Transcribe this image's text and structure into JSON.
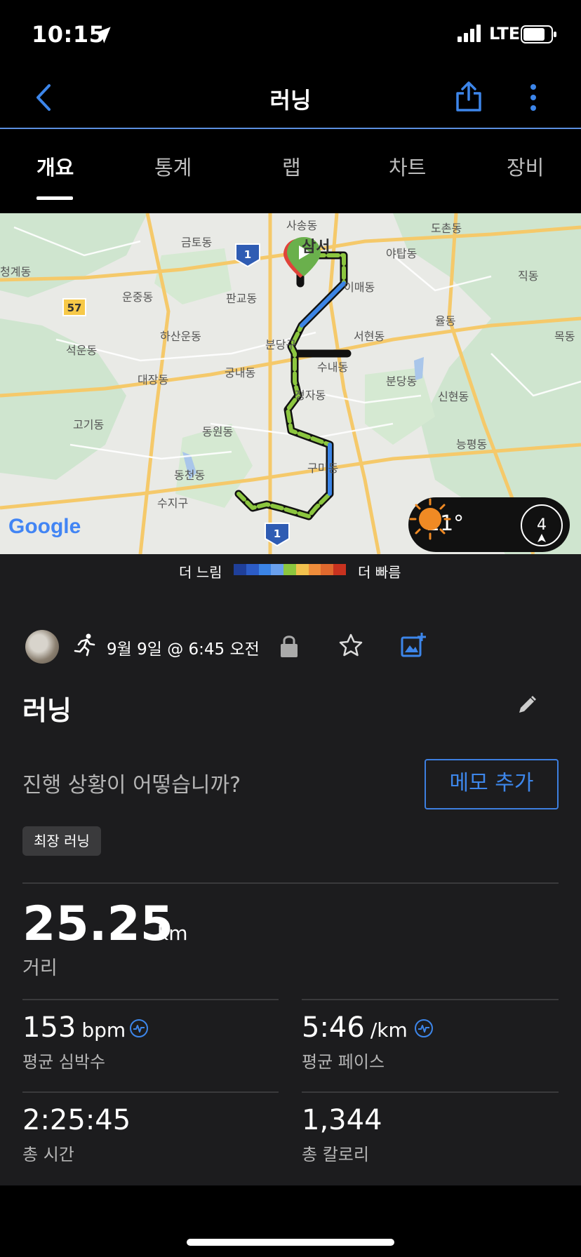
{
  "status": {
    "time": "10:15",
    "network": "LTE"
  },
  "nav": {
    "title": "러닝"
  },
  "tabs": [
    "개요",
    "통계",
    "랩",
    "차트",
    "장비"
  ],
  "map": {
    "labels": [
      "사송동",
      "도촌동",
      "금토동",
      "야탑동",
      "청계동",
      "이매동",
      "직동",
      "운중동",
      "판교동",
      "율동",
      "목동",
      "하산운동",
      "분당구",
      "서현동",
      "석운동",
      "수내동",
      "대장동",
      "궁내동",
      "분당동",
      "정자동",
      "신현동",
      "고기동",
      "동원동",
      "능평동",
      "동천동",
      "구미동",
      "수지구",
      "삼서"
    ],
    "road_numbers": [
      "1",
      "57",
      "1"
    ],
    "google": "Google",
    "temperature": "21°",
    "wind_speed": "4"
  },
  "legend": {
    "slow": "더 느림",
    "fast": "더 빠름",
    "colors": [
      "#1f3f9a",
      "#2c5cc7",
      "#3b84e6",
      "#6aa0ee",
      "#8cc63f",
      "#f2c14e",
      "#ef8d3b",
      "#e0692e",
      "#c8321f"
    ]
  },
  "activity": {
    "date": "9월 9일 @ 6:45 오전",
    "title": "러닝",
    "prompt": "진행 상황이 어떻습니까?",
    "memo_button": "메모 추가",
    "badge": "최장 러닝"
  },
  "stats": {
    "distance": {
      "value": "25.25",
      "unit": "km",
      "label": "거리"
    },
    "heart_rate": {
      "value": "153",
      "unit": "bpm",
      "label": "평균 심박수"
    },
    "pace": {
      "value": "5:46",
      "unit": "/km",
      "label": "평균 페이스"
    },
    "time": {
      "value": "2:25:45",
      "label": "총 시간"
    },
    "calories": {
      "value": "1,344",
      "label": "총 칼로리"
    }
  }
}
